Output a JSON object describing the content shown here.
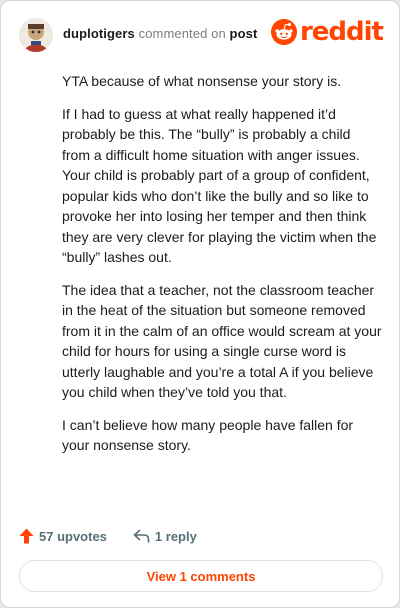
{
  "comment": {
    "username": "duplotigers",
    "action_text": "commented on",
    "target_text": "post",
    "brand": "reddit",
    "paragraphs": [
      "YTA because of what nonsense your story is.",
      "If I had to guess at what really happened it’d probably be this. The “bully” is probably a child from a difficult home situation with anger issues. Your child is probably part of a group of confident, popular kids who don’t like the bully and so like to provoke her into losing her temper and then think they are very clever for playing the victim when the “bully” lashes out.",
      "The idea that a teacher, not the classroom teacher in the heat of the situation but someone removed from it in the calm of an office would scream at your child for hours for using a single curse word is utterly laughable and you’re a total A if you believe you child when they’ve told you that.",
      "I can’t believe how many people have fallen for your nonsense story."
    ]
  },
  "actions": {
    "upvotes": "57 upvotes",
    "replies": "1 reply",
    "view_comments": "View 1 comments"
  },
  "icons": {
    "upvote": "arrow-up-icon",
    "reply": "reply-arrow-icon",
    "brand": "reddit-snoo-icon",
    "avatar": "user-avatar"
  },
  "colors": {
    "brand": "#ff4500",
    "muted": "#576f76",
    "text": "#1c1c1c"
  }
}
